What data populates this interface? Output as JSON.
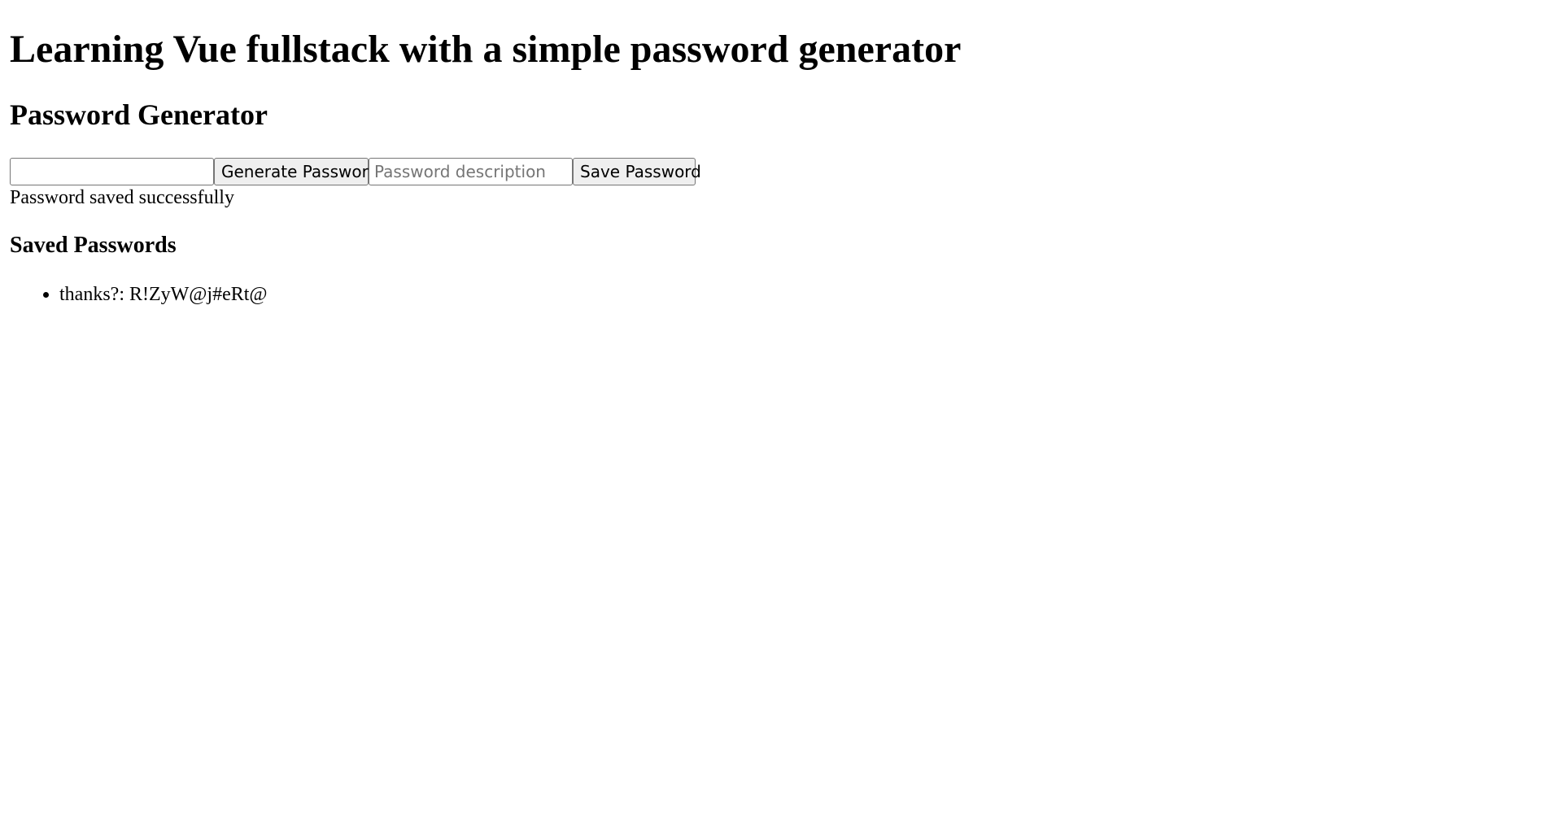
{
  "app": {
    "title": "Learning Vue fullstack with a simple password generator"
  },
  "generator": {
    "heading": "Password Generator",
    "password_value": "",
    "generate_label": "Generate Password",
    "description_value": "",
    "description_placeholder": "Password description",
    "save_label": "Save Password",
    "status_message": "Password saved successfully"
  },
  "saved": {
    "heading": "Saved Passwords",
    "items": [
      {
        "description": "thanks?",
        "password": "R!ZyW@j#eRt@",
        "text": "thanks?: R!ZyW@j#eRt@"
      }
    ]
  }
}
